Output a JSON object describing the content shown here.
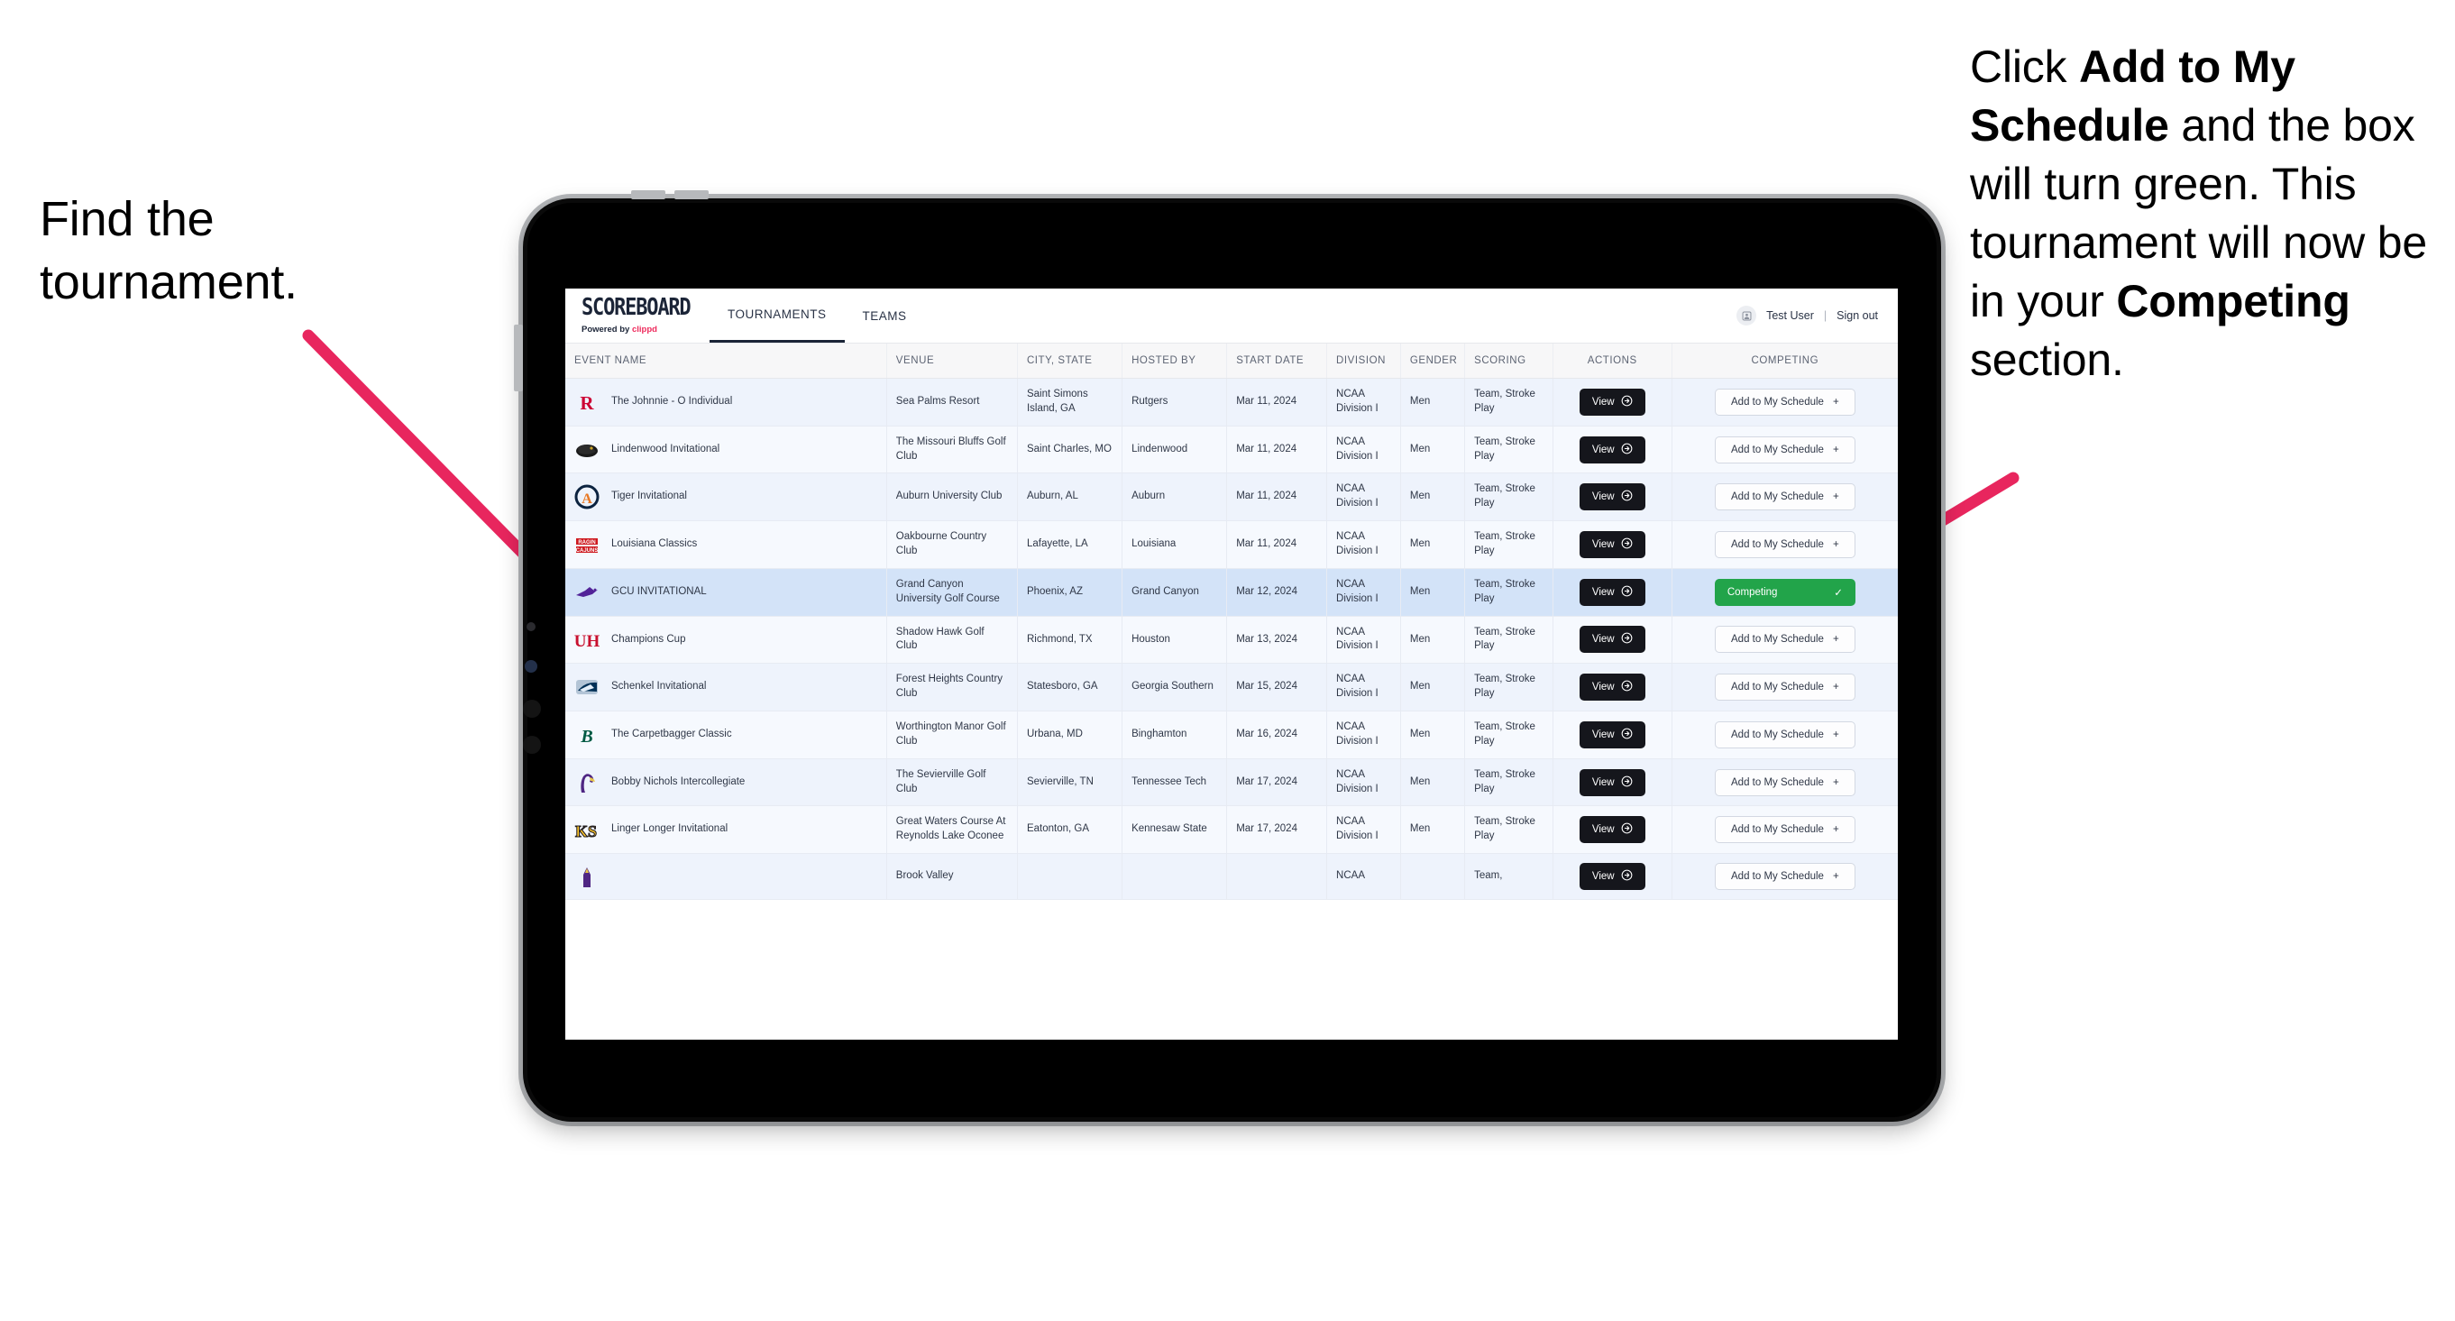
{
  "annotations": {
    "left": "Find the tournament.",
    "right_parts": [
      {
        "t": "Click ",
        "b": false
      },
      {
        "t": "Add to My Schedule",
        "b": true
      },
      {
        "t": " and the box will turn green. This tournament will now be in your ",
        "b": false
      },
      {
        "t": "Competing",
        "b": true
      },
      {
        "t": " section.",
        "b": false
      }
    ],
    "arrow_color": "#e8265e"
  },
  "app": {
    "brand_title": "SCOREBOARD",
    "brand_sub_prefix": "Powered by ",
    "brand_sub_name": "clippd",
    "tabs": [
      {
        "label": "TOURNAMENTS",
        "active": true
      },
      {
        "label": "TEAMS",
        "active": false
      }
    ],
    "user_name": "Test User",
    "separator": "|",
    "sign_out": "Sign out",
    "avatar_icon": "user-avatar-icon"
  },
  "table": {
    "columns": [
      "EVENT NAME",
      "VENUE",
      "CITY, STATE",
      "HOSTED BY",
      "START DATE",
      "DIVISION",
      "GENDER",
      "SCORING",
      "ACTIONS",
      "COMPETING"
    ],
    "view_label": "View",
    "add_label": "Add to My Schedule",
    "add_plus": "+",
    "competing_label": "Competing",
    "competing_check": "✓",
    "competing_color": "#22a44a",
    "rows": [
      {
        "event": "The Johnnie - O Individual",
        "venue": "Sea Palms Resort",
        "city": "Saint Simons Island, GA",
        "host": "Rutgers",
        "date": "Mar 11, 2024",
        "division": "NCAA Division I",
        "gender": "Men",
        "scoring": "Team, Stroke Play",
        "competing": false,
        "logo": "rutgers-logo"
      },
      {
        "event": "Lindenwood Invitational",
        "venue": "The Missouri Bluffs Golf Club",
        "city": "Saint Charles, MO",
        "host": "Lindenwood",
        "date": "Mar 11, 2024",
        "division": "NCAA Division I",
        "gender": "Men",
        "scoring": "Team, Stroke Play",
        "competing": false,
        "logo": "lindenwood-logo"
      },
      {
        "event": "Tiger Invitational",
        "venue": "Auburn University Club",
        "city": "Auburn, AL",
        "host": "Auburn",
        "date": "Mar 11, 2024",
        "division": "NCAA Division I",
        "gender": "Men",
        "scoring": "Team, Stroke Play",
        "competing": false,
        "logo": "auburn-logo"
      },
      {
        "event": "Louisiana Classics",
        "venue": "Oakbourne Country Club",
        "city": "Lafayette, LA",
        "host": "Louisiana",
        "date": "Mar 11, 2024",
        "division": "NCAA Division I",
        "gender": "Men",
        "scoring": "Team, Stroke Play",
        "competing": false,
        "logo": "louisiana-ragin-cajuns-logo"
      },
      {
        "event": "GCU INVITATIONAL",
        "venue": "Grand Canyon University Golf Course",
        "city": "Phoenix, AZ",
        "host": "Grand Canyon",
        "date": "Mar 12, 2024",
        "division": "NCAA Division I",
        "gender": "Men",
        "scoring": "Team, Stroke Play",
        "competing": true,
        "logo": "grand-canyon-lopes-logo"
      },
      {
        "event": "Champions Cup",
        "venue": "Shadow Hawk Golf Club",
        "city": "Richmond, TX",
        "host": "Houston",
        "date": "Mar 13, 2024",
        "division": "NCAA Division I",
        "gender": "Men",
        "scoring": "Team, Stroke Play",
        "competing": false,
        "logo": "houston-logo"
      },
      {
        "event": "Schenkel Invitational",
        "venue": "Forest Heights Country Club",
        "city": "Statesboro, GA",
        "host": "Georgia Southern",
        "date": "Mar 15, 2024",
        "division": "NCAA Division I",
        "gender": "Men",
        "scoring": "Team, Stroke Play",
        "competing": false,
        "logo": "georgia-southern-logo"
      },
      {
        "event": "The Carpetbagger Classic",
        "venue": "Worthington Manor Golf Club",
        "city": "Urbana, MD",
        "host": "Binghamton",
        "date": "Mar 16, 2024",
        "division": "NCAA Division I",
        "gender": "Men",
        "scoring": "Team, Stroke Play",
        "competing": false,
        "logo": "binghamton-logo"
      },
      {
        "event": "Bobby Nichols Intercollegiate",
        "venue": "The Sevierville Golf Club",
        "city": "Sevierville, TN",
        "host": "Tennessee Tech",
        "date": "Mar 17, 2024",
        "division": "NCAA Division I",
        "gender": "Men",
        "scoring": "Team, Stroke Play",
        "competing": false,
        "logo": "tennessee-tech-logo"
      },
      {
        "event": "Linger Longer Invitational",
        "venue": "Great Waters Course At Reynolds Lake Oconee",
        "city": "Eatonton, GA",
        "host": "Kennesaw State",
        "date": "Mar 17, 2024",
        "division": "NCAA Division I",
        "gender": "Men",
        "scoring": "Team, Stroke Play",
        "competing": false,
        "logo": "kennesaw-state-logo"
      },
      {
        "event": "",
        "venue": "Brook Valley",
        "city": "",
        "host": "",
        "date": "",
        "division": "NCAA",
        "gender": "",
        "scoring": "Team,",
        "competing": false,
        "logo": "partial-row-logo"
      }
    ]
  }
}
